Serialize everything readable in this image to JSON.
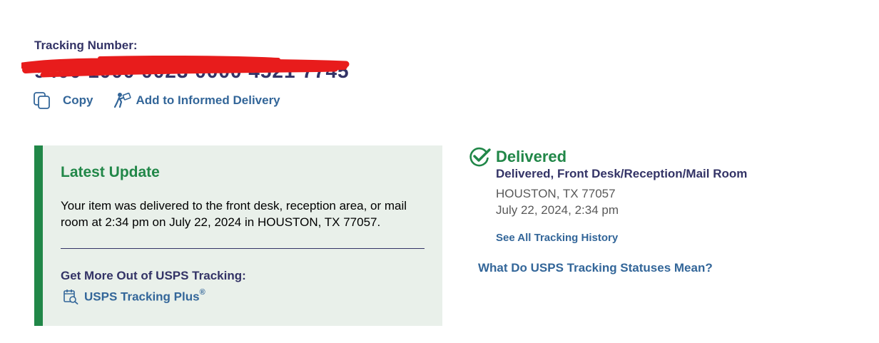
{
  "tracking": {
    "label": "Tracking Number:",
    "number": "9400 1000 0023 0000 4521 7745",
    "redaction_color": "#e81c1c"
  },
  "actions": {
    "copy_label": "Copy",
    "copy_icon": "copy-icon",
    "informed_label": "Add to Informed Delivery",
    "informed_icon": "mail-carrier-icon"
  },
  "latest_update": {
    "title": "Latest Update",
    "body": "Your item was delivered to the front desk, reception area, or mail room at 2:34 pm on July 22, 2024 in HOUSTON, TX 77057.",
    "more_title": "Get More Out of USPS Tracking:",
    "plus_label": "USPS Tracking Plus",
    "plus_mark": "®",
    "plus_icon": "tracking-plus-icon"
  },
  "status": {
    "title": "Delivered",
    "icon": "check-circle-icon",
    "detail": "Delivered, Front Desk/Reception/Mail Room",
    "location": "HOUSTON, TX 77057",
    "time": "July 22, 2024, 2:34 pm",
    "history_link": "See All Tracking History",
    "meaning_link": "What Do USPS Tracking Statuses Mean?"
  },
  "colors": {
    "navy": "#333366",
    "link_blue": "#336699",
    "green": "#218748",
    "panel_bg": "#e9f0ea",
    "gray_text": "#595959"
  }
}
